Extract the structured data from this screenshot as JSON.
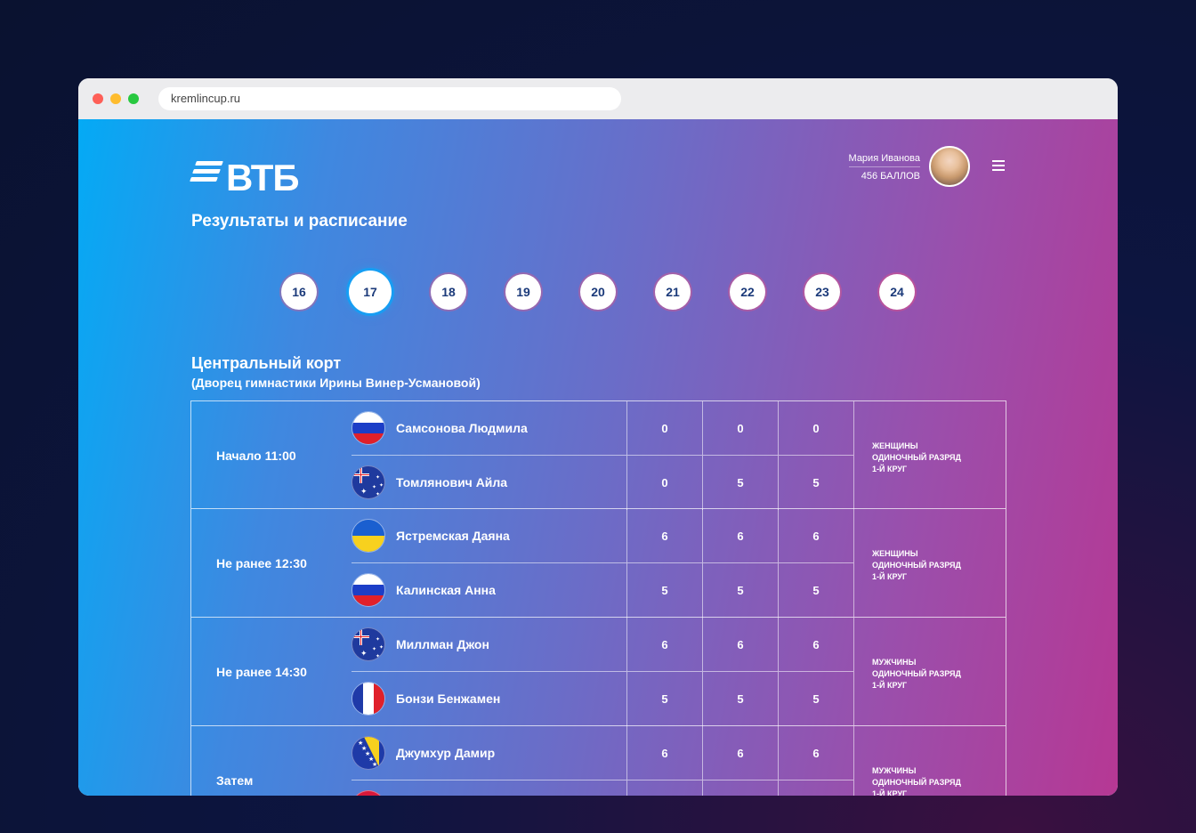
{
  "browser": {
    "url": "kremlincup.ru"
  },
  "header": {
    "logo_text": "ВТБ",
    "page_title": "Результаты и расписание",
    "user_name": "Мария Иванова",
    "user_points": "456 БАЛЛОВ"
  },
  "dates": [
    "16",
    "17",
    "18",
    "19",
    "20",
    "21",
    "22",
    "23",
    "24"
  ],
  "active_date": "17",
  "court": {
    "title": "Центральный корт",
    "subtitle": "(Дворец гимнастики Ирины Винер-Усмановой)"
  },
  "matches": [
    {
      "time": "Начало 11:00",
      "category": [
        "ЖЕНЩИНЫ",
        "ОДИНОЧНЫЙ РАЗРЯД",
        "1-Й КРУГ"
      ],
      "players": [
        {
          "flag": "russia-flag-icon",
          "name": "Самсонова Людмила",
          "scores": [
            "0",
            "0",
            "0"
          ]
        },
        {
          "flag": "australia-flag-icon",
          "name": "Томлянович Айла",
          "scores": [
            "0",
            "5",
            "5"
          ]
        }
      ]
    },
    {
      "time": "Не ранее 12:30",
      "category": [
        "ЖЕНЩИНЫ",
        "ОДИНОЧНЫЙ РАЗРЯД",
        "1-Й КРУГ"
      ],
      "players": [
        {
          "flag": "ukraine-flag-icon",
          "name": "Ястремская Даяна",
          "scores": [
            "6",
            "6",
            "6"
          ]
        },
        {
          "flag": "russia-flag-icon",
          "name": "Калинская Анна",
          "scores": [
            "5",
            "5",
            "5"
          ]
        }
      ]
    },
    {
      "time": "Не ранее 14:30",
      "category": [
        "МУЖЧИНЫ",
        "ОДИНОЧНЫЙ РАЗРЯД",
        "1-Й КРУГ"
      ],
      "players": [
        {
          "flag": "australia-flag-icon",
          "name": "Миллман Джон",
          "scores": [
            "6",
            "6",
            "6"
          ]
        },
        {
          "flag": "france-flag-icon",
          "name": "Бонзи Бенжамен",
          "scores": [
            "5",
            "5",
            "5"
          ]
        }
      ]
    },
    {
      "time": "Затем",
      "category": [
        "МУЖЧИНЫ",
        "ОДИНОЧНЫЙ РАЗРЯД",
        "1-Й КРУГ"
      ],
      "players": [
        {
          "flag": "bosnia-flag-icon",
          "name": "Джумхур Дамир",
          "scores": [
            "6",
            "6",
            "6"
          ]
        },
        {
          "flag": "red-flag-icon",
          "name": "",
          "scores": [
            "",
            "",
            ""
          ]
        }
      ]
    }
  ],
  "colors": {
    "gradient_start": "#04aaf5",
    "gradient_mid": "#6a6dc8",
    "gradient_end": "#b63894",
    "date_text": "#1b3a7a"
  }
}
